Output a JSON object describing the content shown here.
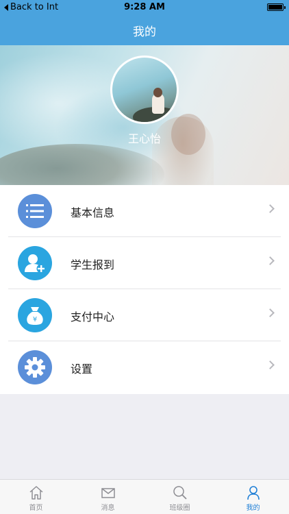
{
  "status_bar": {
    "back_label": "Back to Int",
    "time": "9:28 AM"
  },
  "header": {
    "title": "我的"
  },
  "profile": {
    "name": "王心怡"
  },
  "menu": {
    "items": [
      {
        "label": "基本信息",
        "icon": "list-icon",
        "color": "#5b8fd9"
      },
      {
        "label": "学生报到",
        "icon": "add-user-icon",
        "color": "#2aa5e0"
      },
      {
        "label": "支付中心",
        "icon": "money-bag-icon",
        "color": "#2aa5e0"
      },
      {
        "label": "设置",
        "icon": "gear-icon",
        "color": "#5b8fd9"
      }
    ]
  },
  "tabbar": {
    "tabs": [
      {
        "label": "首页",
        "icon": "home-icon",
        "active": false
      },
      {
        "label": "消息",
        "icon": "mail-icon",
        "active": false
      },
      {
        "label": "班级圈",
        "icon": "search-icon",
        "active": false
      },
      {
        "label": "我的",
        "icon": "person-icon",
        "active": true
      }
    ]
  },
  "colors": {
    "header_bg": "#4aa3de",
    "active_tab": "#1f7fd6"
  }
}
